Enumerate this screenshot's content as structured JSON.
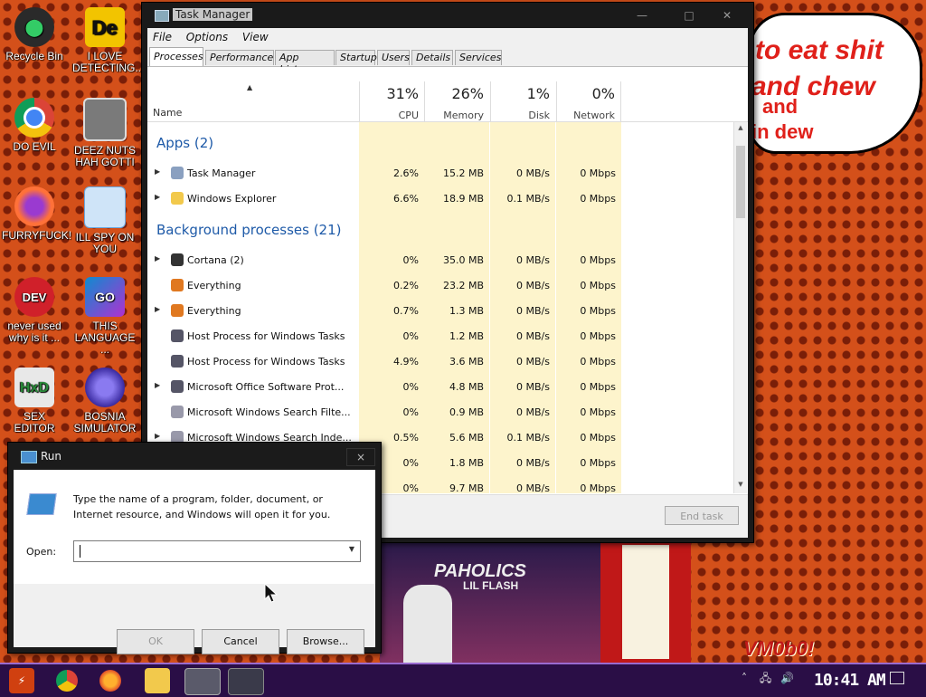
{
  "desktop": {
    "icons": [
      {
        "label": "Recycle Bin",
        "icon": "recycle-bin-icon",
        "color": "#2a2a2a"
      },
      {
        "label": "I LOVE DETECTING...",
        "icon": "detect-it-easy-icon",
        "color": "#f2c400"
      },
      {
        "label": "DO EVIL",
        "icon": "chrome-icon",
        "color": "#4285f4"
      },
      {
        "label": "DEEZ NUTS HAH GOTTI",
        "icon": "windows-stack-icon",
        "color": "#7a7a7a"
      },
      {
        "label": "FURRYFUCK!",
        "icon": "firefox-icon",
        "color": "#ff7139"
      },
      {
        "label": "ILL SPY ON YOU",
        "icon": "network-icon",
        "color": "#6aa8e0"
      },
      {
        "label": "never used why is it ...",
        "icon": "dev-cpp-icon",
        "color": "#d0202a"
      },
      {
        "label": "THIS LANGUAGE ...",
        "icon": "goland-icon",
        "color": "#0e8bd0"
      },
      {
        "label": "SEX EDITOR",
        "icon": "hxd-icon",
        "color": "#e8e8e8"
      },
      {
        "label": "BOSNIA SIMULATOR",
        "icon": "bosnia-sphere-icon",
        "color": "#5a4ad0"
      }
    ]
  },
  "meme": {
    "line1": "to eat shit",
    "line2": "and chew",
    "line3": "and",
    "line4": "in dew"
  },
  "task_manager": {
    "title": "Task Manager",
    "menu": [
      "File",
      "Options",
      "View"
    ],
    "tabs": [
      "Processes",
      "Performance",
      "App history",
      "Startup",
      "Users",
      "Details",
      "Services"
    ],
    "active_tab": "Processes",
    "columns": {
      "name": "Name",
      "cpu": {
        "pct": "31%",
        "label": "CPU"
      },
      "memory": {
        "pct": "26%",
        "label": "Memory"
      },
      "disk": {
        "pct": "1%",
        "label": "Disk"
      },
      "network": {
        "pct": "0%",
        "label": "Network"
      }
    },
    "groups": {
      "apps": "Apps (2)",
      "background": "Background processes (21)"
    },
    "rows": [
      {
        "name": "Task Manager",
        "cpu": "2.6%",
        "mem": "15.2 MB",
        "disk": "0 MB/s",
        "net": "0 Mbps",
        "icon": "task-manager-icon"
      },
      {
        "name": "Windows Explorer",
        "cpu": "6.6%",
        "mem": "18.9 MB",
        "disk": "0.1 MB/s",
        "net": "0 Mbps",
        "icon": "folder-icon"
      },
      {
        "name": "Cortana (2)",
        "cpu": "0%",
        "mem": "35.0 MB",
        "disk": "0 MB/s",
        "net": "0 Mbps",
        "icon": "cortana-icon"
      },
      {
        "name": "Everything",
        "cpu": "0.2%",
        "mem": "23.2 MB",
        "disk": "0 MB/s",
        "net": "0 Mbps",
        "icon": "magnifier-icon"
      },
      {
        "name": "Everything",
        "cpu": "0.7%",
        "mem": "1.3 MB",
        "disk": "0 MB/s",
        "net": "0 Mbps",
        "icon": "magnifier-icon"
      },
      {
        "name": "Host Process for Windows Tasks",
        "cpu": "0%",
        "mem": "1.2 MB",
        "disk": "0 MB/s",
        "net": "0 Mbps",
        "icon": "host-process-icon"
      },
      {
        "name": "Host Process for Windows Tasks",
        "cpu": "4.9%",
        "mem": "3.6 MB",
        "disk": "0 MB/s",
        "net": "0 Mbps",
        "icon": "host-process-icon"
      },
      {
        "name": "Microsoft Office Software Prot...",
        "cpu": "0%",
        "mem": "4.8 MB",
        "disk": "0 MB/s",
        "net": "0 Mbps",
        "icon": "host-process-icon"
      },
      {
        "name": "Microsoft Windows Search Filte...",
        "cpu": "0%",
        "mem": "0.9 MB",
        "disk": "0 MB/s",
        "net": "0 Mbps",
        "icon": "search-process-icon"
      },
      {
        "name": "Microsoft Windows Search Inde...",
        "cpu": "0.5%",
        "mem": "5.6 MB",
        "disk": "0.1 MB/s",
        "net": "0 Mbps",
        "icon": "search-process-icon"
      },
      {
        "name": "",
        "cpu": "0%",
        "mem": "1.8 MB",
        "disk": "0 MB/s",
        "net": "0 Mbps",
        "icon": ""
      },
      {
        "name": "",
        "cpu": "0%",
        "mem": "9.7 MB",
        "disk": "0 MB/s",
        "net": "0 Mbps",
        "icon": ""
      }
    ],
    "end_task": "End task"
  },
  "run_dialog": {
    "title": "Run",
    "close": "×",
    "description": "Type the name of a program, folder, document, or Internet resource, and Windows will open it for you.",
    "open_label": "Open:",
    "open_value": "",
    "ok": "OK",
    "cancel": "Cancel",
    "browse": "Browse..."
  },
  "background": {
    "album_title": "PAHOLICS",
    "album_artist": "LIL FLASH",
    "watermark": "VM0b0!"
  },
  "taskbar": {
    "clock": "10:41 AM",
    "tray_icons": [
      "chevron-up-icon",
      "network-icon",
      "volume-icon"
    ]
  }
}
